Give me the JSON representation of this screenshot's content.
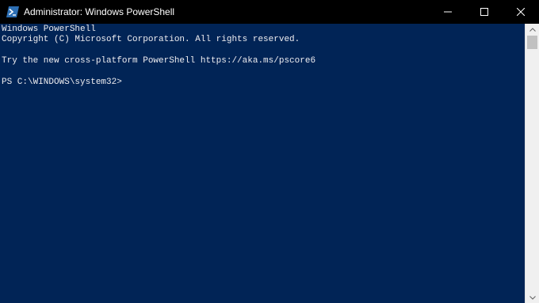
{
  "window": {
    "title": "Administrator: Windows PowerShell",
    "icons": {
      "app": "powershell-icon",
      "minimize": "minimize-icon",
      "maximize": "maximize-icon",
      "close": "close-icon"
    }
  },
  "console": {
    "lines": [
      "Windows PowerShell",
      "Copyright (C) Microsoft Corporation. All rights reserved.",
      "",
      "Try the new cross-platform PowerShell https://aka.ms/pscore6",
      "",
      "PS C:\\WINDOWS\\system32>"
    ]
  },
  "colors": {
    "background": "#012456",
    "titlebar": "#000000",
    "text": "#eeedf0"
  }
}
